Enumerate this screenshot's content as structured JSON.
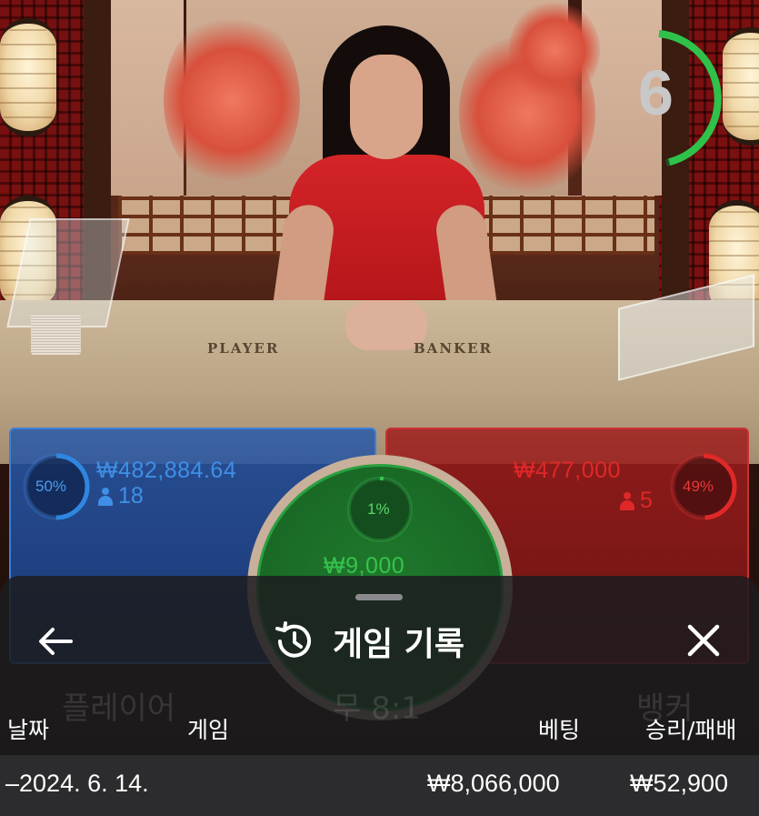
{
  "video": {
    "timer": "6",
    "table_labels": {
      "player": "PLAYER",
      "banker": "BANKER"
    }
  },
  "bets": {
    "player": {
      "percent": "50%",
      "amount": "₩482,884.64",
      "players": "18",
      "color": "#2f86e0"
    },
    "banker": {
      "percent": "49%",
      "amount": "₩477,000",
      "players": "5",
      "color": "#e02828"
    },
    "tie": {
      "percent": "1%",
      "amount": "₩9,000",
      "color": "#37c24c"
    }
  },
  "history_sheet": {
    "title": "게임 기록",
    "icons": {
      "back": "back-arrow-icon",
      "history": "history-clock-icon",
      "close": "close-icon"
    },
    "background_labels": {
      "player": "플레이어",
      "tie": "무 8:1",
      "banker": "뱅커"
    },
    "columns": {
      "date": "날짜",
      "game": "게임",
      "bet": "베팅",
      "result": "승리/패배"
    },
    "rows": [
      {
        "date": "–2024. 6. 14.",
        "bet": "₩8,066,000",
        "result": "₩52,900"
      }
    ]
  }
}
